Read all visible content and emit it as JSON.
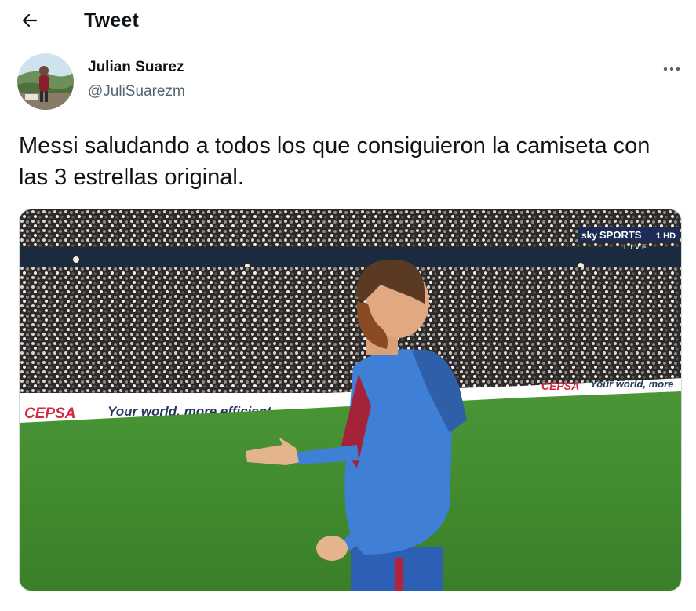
{
  "header": {
    "title": "Tweet",
    "back_icon": "arrow-left-icon"
  },
  "author": {
    "display_name": "Julian Suarez",
    "handle": "@JuliSuarezm",
    "avatar_icon": "user-avatar"
  },
  "tweet": {
    "text": "Messi saludando a todos los que consiguieron la camiseta con las 3 estrellas original.",
    "more_icon": "more-horizontal-icon"
  },
  "media": {
    "broadcaster": "SPORTS",
    "broadcaster_prefix": "sky",
    "channel": "1 HD",
    "live": "LIVE",
    "board_left_brand": "CEPSA",
    "board_left_slogan": "Your world, more efficient",
    "board_right_brand": "CEPSA",
    "board_right_slogan": "Your world, more"
  },
  "colors": {
    "text_primary": "#0f1419",
    "text_secondary": "#536471",
    "pitch": "#3f8a2e",
    "kit_blue": "#3f7fd6",
    "board_red": "#d7263d"
  }
}
